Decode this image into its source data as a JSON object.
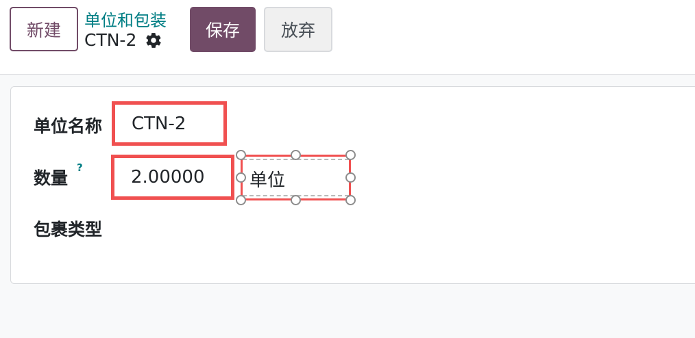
{
  "control_panel": {
    "new_label": "新建",
    "save_label": "保存",
    "discard_label": "放弃",
    "breadcrumb": "单位和包装",
    "record_title": "CTN-2"
  },
  "form": {
    "unit_name_label": "单位名称",
    "unit_name_value": "CTN-2",
    "quantity_label": "数量",
    "quantity_help": "?",
    "quantity_value": "2.00000",
    "uom_value": "单位",
    "package_type_label": "包裹类型"
  },
  "colors": {
    "brand": "#714b67",
    "link": "#017e84",
    "highlight": "#f05050"
  }
}
